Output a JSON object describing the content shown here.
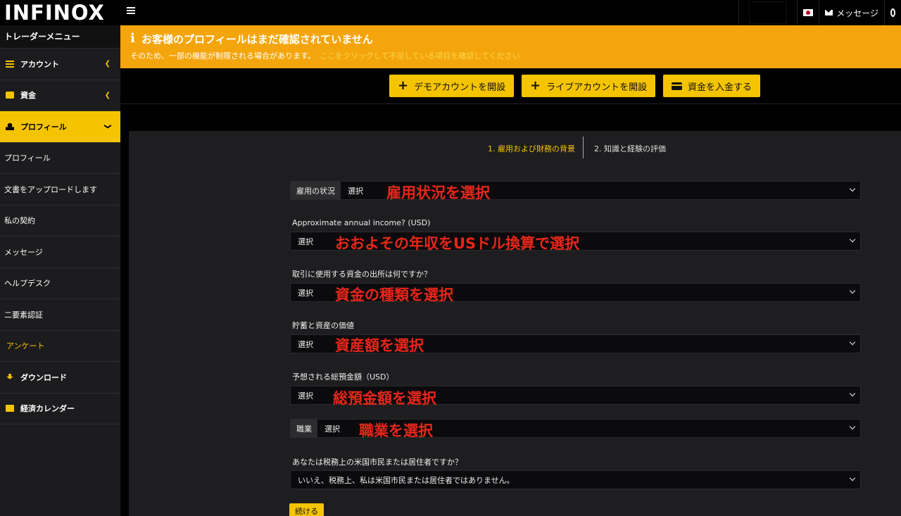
{
  "topbar": {
    "logo": "INFINOX",
    "messages_label": "メッセージ"
  },
  "sidebar": {
    "header": "トレーダーメニュー",
    "items": [
      {
        "label": "アカウント",
        "icon": "list-icon"
      },
      {
        "label": "資金",
        "icon": "wallet-icon"
      },
      {
        "label": "プロフィール",
        "icon": "user-icon"
      }
    ],
    "sub_items": [
      "プロフィール",
      "文書をアップロードします",
      "私の契約",
      "メッセージ",
      "ヘルプデスク",
      "二要素認証",
      "アンケート"
    ],
    "bottom_items": [
      {
        "label": "ダウンロード",
        "icon": "download-icon"
      },
      {
        "label": "経済カレンダー",
        "icon": "calendar-icon"
      }
    ]
  },
  "banner": {
    "icon": "i",
    "title": "お客様のプロフィールはまだ確認されていません",
    "subtitle": "そのため、一部の機能が制限される場合があります。",
    "link": "ここをクリックして不足している項目を確認してください"
  },
  "actions": {
    "demo": "デモアカウントを開設",
    "live": "ライブアカウントを開設",
    "deposit": "資金を入金する"
  },
  "steps": {
    "step1": "1. 雇用および財務の背景",
    "step2": "2. 知識と経験の評価"
  },
  "form": {
    "employment": {
      "prefix": "雇用の状況",
      "value": "選択",
      "annotation": "雇用状況を選択"
    },
    "income": {
      "label": "Approximate annual income? (USD)",
      "value": "選択",
      "annotation": "おおよその年収をUSドル換算で選択"
    },
    "source": {
      "label": "取引に使用する資金の出所は何ですか？",
      "value": "選択",
      "annotation": "資金の種類を選択"
    },
    "savings": {
      "label": "貯蓄と資産の価値",
      "value": "選択",
      "annotation": "資産額を選択"
    },
    "deposit": {
      "label": "予想される総預金額（USD）",
      "value": "選択",
      "annotation": "総預金額を選択"
    },
    "occupation": {
      "prefix": "職業",
      "value": "選択",
      "annotation": "職業を選択"
    },
    "us_citizen": {
      "label": "あなたは税務上の米国市民または居住者ですか？",
      "value": "いいえ、税務上、私は米国市民または居住者ではありません。"
    },
    "continue": "続ける"
  },
  "colors": {
    "accent": "#f5c400",
    "banner": "#f5a50c",
    "annotation": "#e8261a"
  }
}
